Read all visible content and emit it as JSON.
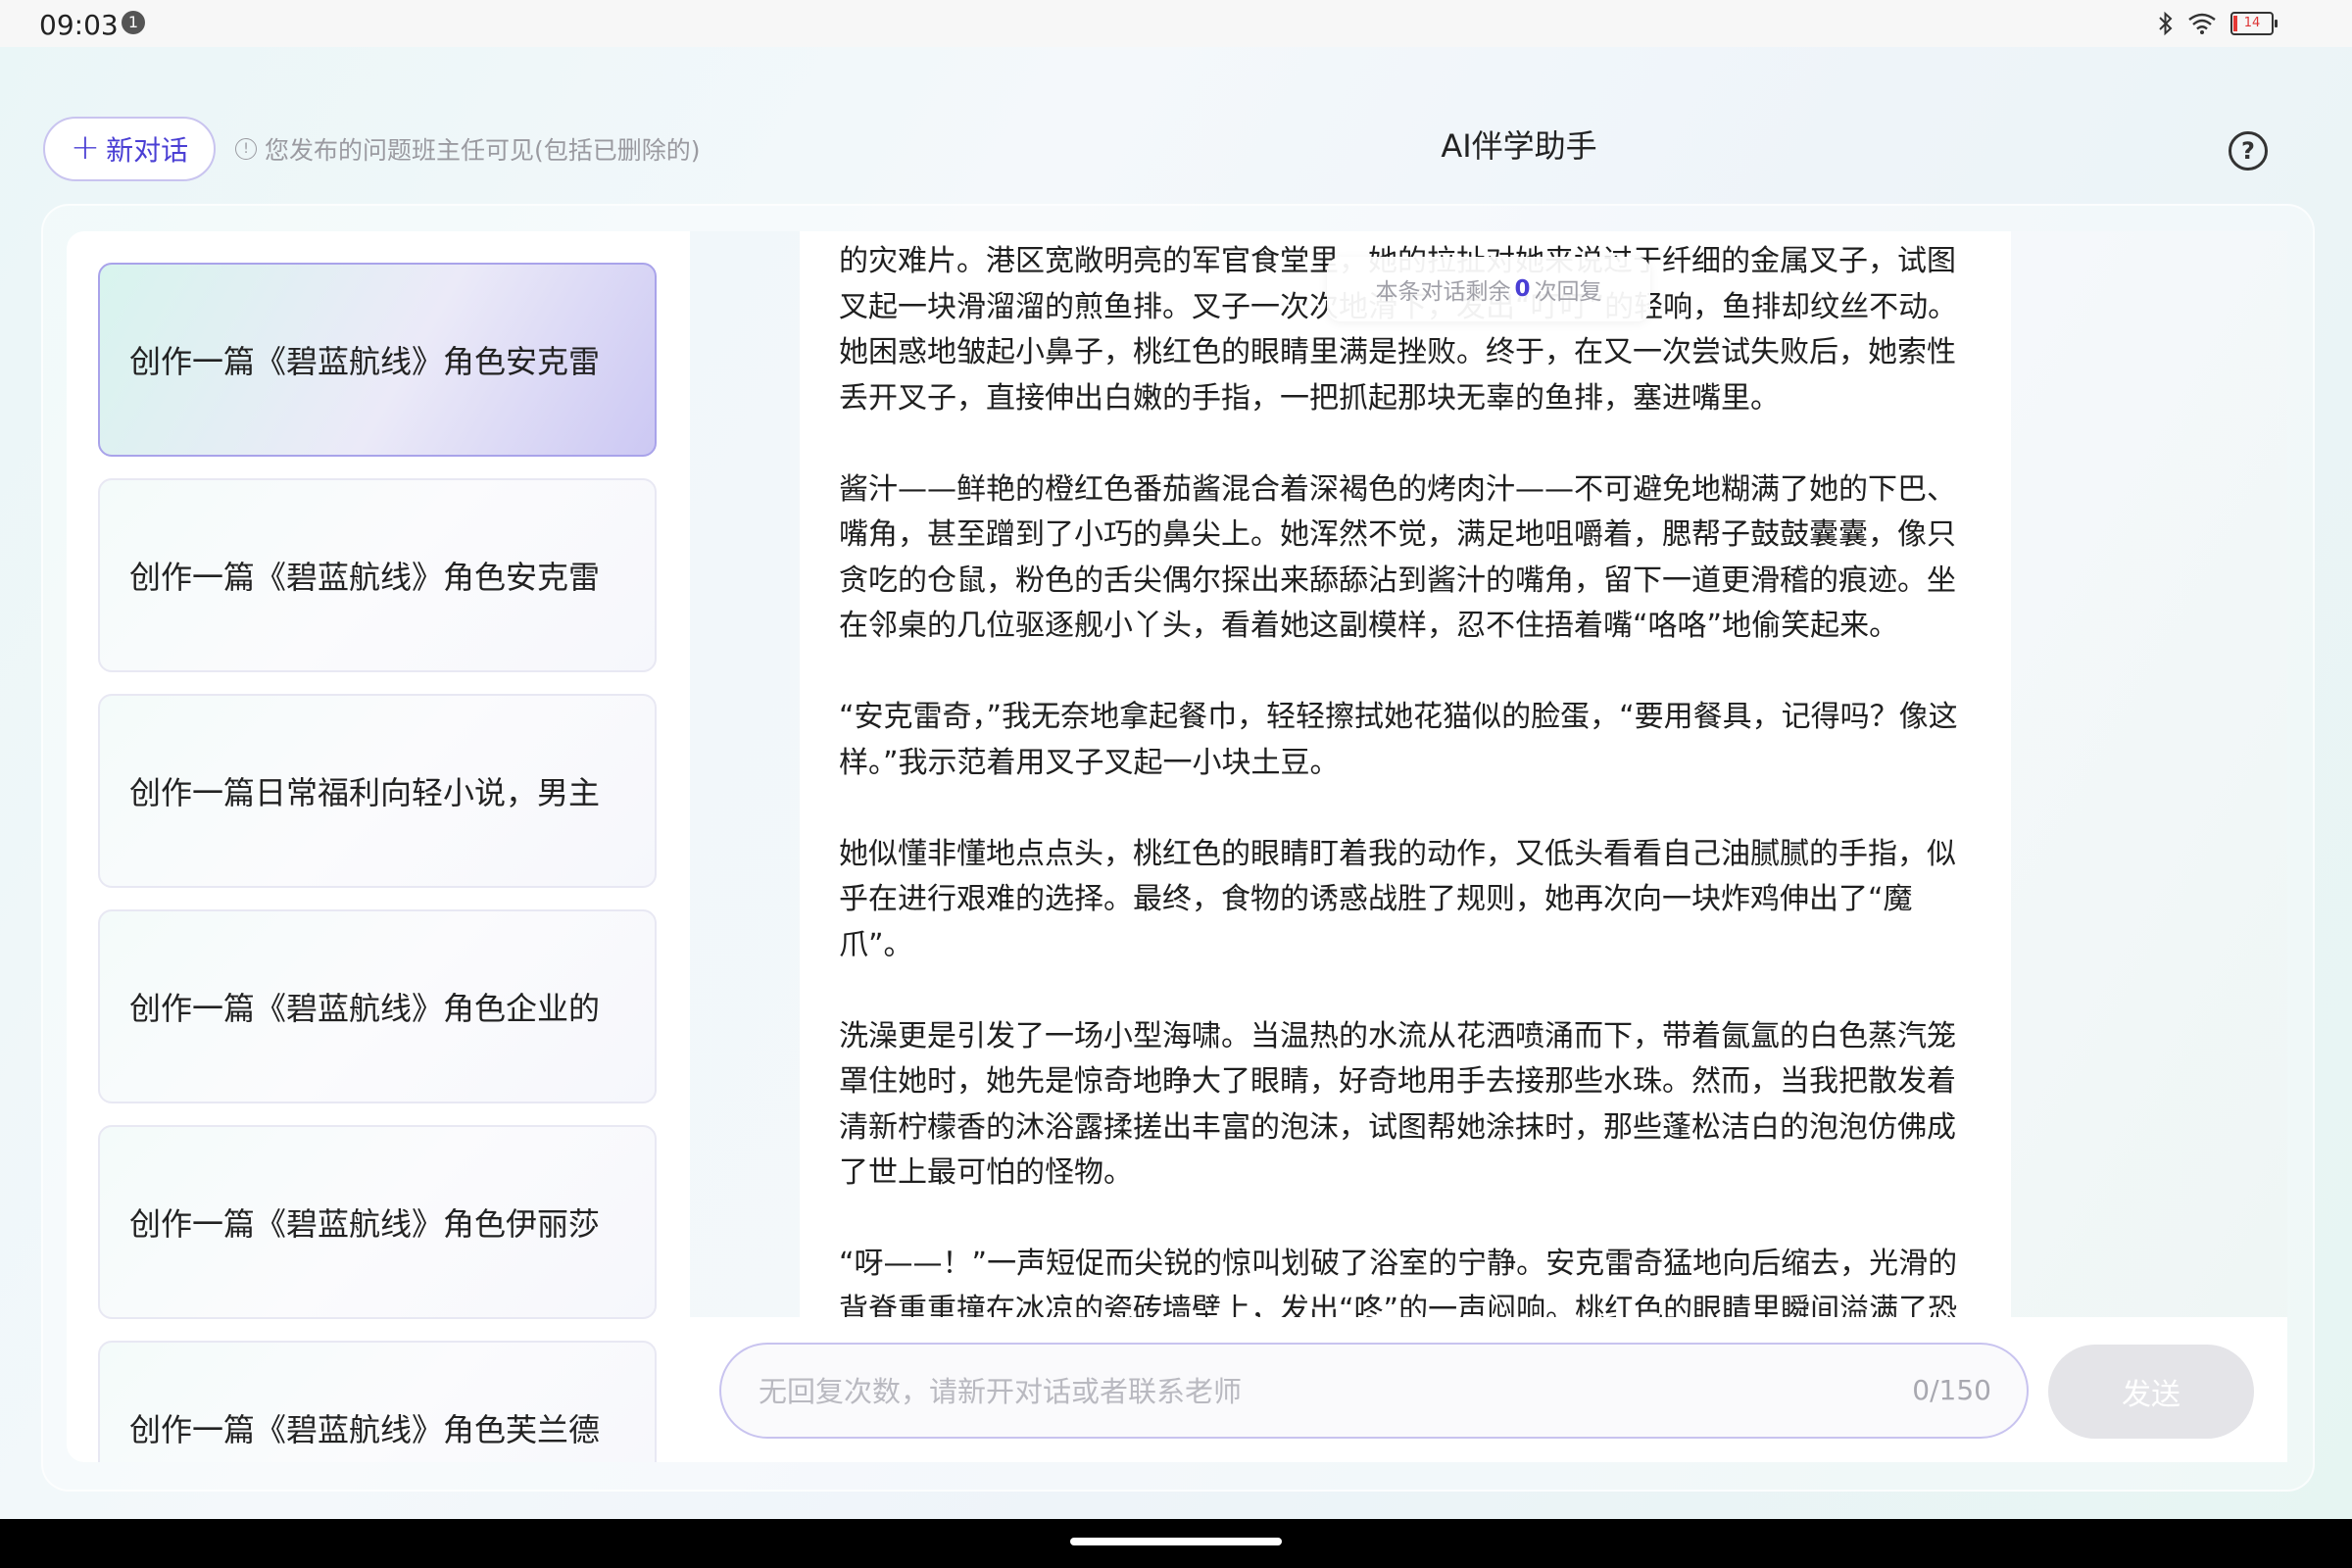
{
  "status_bar": {
    "time": "09:03",
    "notification_count": "1",
    "battery_level": "14"
  },
  "header": {
    "new_chat_label": "新对话",
    "notice": "您发布的问题班主任可见(包括已删除的)",
    "title": "AI伴学助手"
  },
  "sidebar": {
    "items": [
      {
        "label": "创作一篇《碧蓝航线》角色安克雷",
        "active": true
      },
      {
        "label": "创作一篇《碧蓝航线》角色安克雷",
        "active": false
      },
      {
        "label": "创作一篇日常福利向轻小说，男主",
        "active": false
      },
      {
        "label": "创作一篇《碧蓝航线》角色企业的",
        "active": false
      },
      {
        "label": "创作一篇《碧蓝航线》角色伊丽莎",
        "active": false
      },
      {
        "label": "创作一篇《碧蓝航线》角色芙兰德",
        "active": false
      }
    ]
  },
  "tip": {
    "prefix": "本条对话剩余",
    "count": "0",
    "suffix": "次回复"
  },
  "message": {
    "paragraphs": [
      "的灾难片。港区宽敞明亮的军官食堂里，她的拉扯对她来说过于纤细的金属叉子，试图叉起一块滑溜溜的煎鱼排。叉子一次次地滑下，发出“叮叮”的轻响，鱼排却纹丝不动。她困惑地皱起小鼻子，桃红色的眼睛里满是挫败。终于，在又一次尝试失败后，她索性丢开叉子，直接伸出白嫩的手指，一把抓起那块无辜的鱼排，塞进嘴里。",
      "酱汁——鲜艳的橙红色番茄酱混合着深褐色的烤肉汁——不可避免地糊满了她的下巴、嘴角，甚至蹭到了小巧的鼻尖上。她浑然不觉，满足地咀嚼着，腮帮子鼓鼓囊囊，像只贪吃的仓鼠，粉色的舌尖偶尔探出来舔舔沾到酱汁的嘴角，留下一道更滑稽的痕迹。坐在邻桌的几位驱逐舰小丫头，看着她这副模样，忍不住捂着嘴“咯咯”地偷笑起来。",
      "“安克雷奇，”我无奈地拿起餐巾，轻轻擦拭她花猫似的脸蛋，“要用餐具，记得吗？像这样。”我示范着用叉子叉起一小块土豆。",
      "她似懂非懂地点点头，桃红色的眼睛盯着我的动作，又低头看看自己油腻腻的手指，似乎在进行艰难的选择。最终，食物的诱惑战胜了规则，她再次向一块炸鸡伸出了“魔爪”。",
      "洗澡更是引发了一场小型海啸。当温热的水流从花洒喷涌而下，带着氤氲的白色蒸汽笼罩住她时，她先是惊奇地睁大了眼睛，好奇地用手去接那些水珠。然而，当我把散发着清新柠檬香的沐浴露揉搓出丰富的泡沫，试图帮她涂抹时，那些蓬松洁白的泡泡仿佛成了世上最可怕的怪物。",
      "“呀——！”一声短促而尖锐的惊叫划破了浴室的宁静。安克雷奇猛地向后缩去，光滑的背脊重重撞在冰凉的瓷砖墙壁上，发出“咚”的一声闷响。桃红色的眼睛里瞬间溢满了恐惧的"
    ]
  },
  "input": {
    "placeholder": "无回复次数，请新开对话或者联系老师",
    "value": "",
    "char_count": "0/150",
    "send_label": "发送"
  },
  "colors": {
    "accent": "#4a3fd4",
    "input_border": "#c8c3ef",
    "send_disabled": "#e4e4e8"
  },
  "icons": {
    "plus": "plus-icon",
    "info": "info-icon",
    "help": "help-circle-icon",
    "bluetooth": "bluetooth-icon",
    "wifi": "wifi-icon",
    "battery": "battery-icon",
    "notification": "notification-badge-icon"
  }
}
